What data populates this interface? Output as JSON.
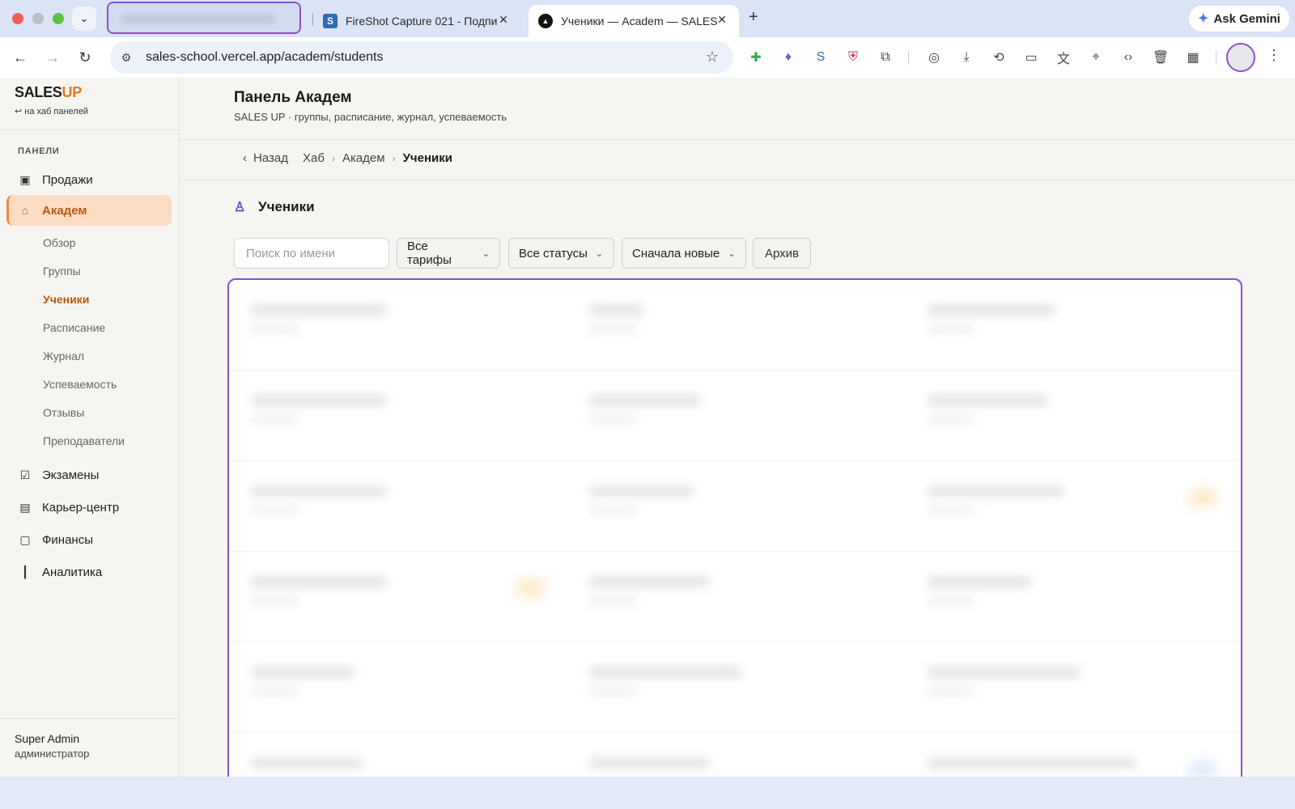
{
  "browser": {
    "tabs": [
      {
        "title": "FireShot Capture 021 - Подпи",
        "favicon": "S"
      },
      {
        "title": "Ученики — Academ — SALES",
        "favicon": "▲"
      }
    ],
    "url_host": "sales-school.vercel.app",
    "url_path": "/academ/students",
    "gemini_label": "Ask Gemini"
  },
  "sidebar": {
    "brand_main": "SALES",
    "brand_accent": "UP",
    "back_link": "↩ на хаб панелей",
    "section_label": "ПАНЕЛИ",
    "items": [
      {
        "label": "Продажи",
        "icon": "briefcase-icon"
      },
      {
        "label": "Академ",
        "icon": "graduation-cap-icon"
      },
      {
        "label": "Экзамены",
        "icon": "clipboard-check-icon"
      },
      {
        "label": "Карьер-центр",
        "icon": "building-icon"
      },
      {
        "label": "Финансы",
        "icon": "wallet-icon"
      },
      {
        "label": "Аналитика",
        "icon": "bar-chart-icon"
      }
    ],
    "subitems": [
      "Обзор",
      "Группы",
      "Ученики",
      "Расписание",
      "Журнал",
      "Успеваемость",
      "Отзывы",
      "Преподаватели"
    ],
    "user": {
      "name": "Super Admin",
      "role": "администратор"
    }
  },
  "header": {
    "title": "Панель Академ",
    "subtitle": "SALES UP · группы, расписание, журнал, успеваемость"
  },
  "breadcrumb": {
    "back": "Назад",
    "items": [
      "Хаб",
      "Академ",
      "Ученики"
    ]
  },
  "section": {
    "title": "Ученики",
    "icon": "user-icon"
  },
  "filters": {
    "search_placeholder": "Поиск по имени",
    "tariff": "Все тарифы",
    "status": "Все статусы",
    "sort": "Сначала новые",
    "archive": "Архив"
  },
  "colors": {
    "accent": "#e07a1a",
    "active_bg": "#fddcc4",
    "focus": "#8b4fd1"
  }
}
